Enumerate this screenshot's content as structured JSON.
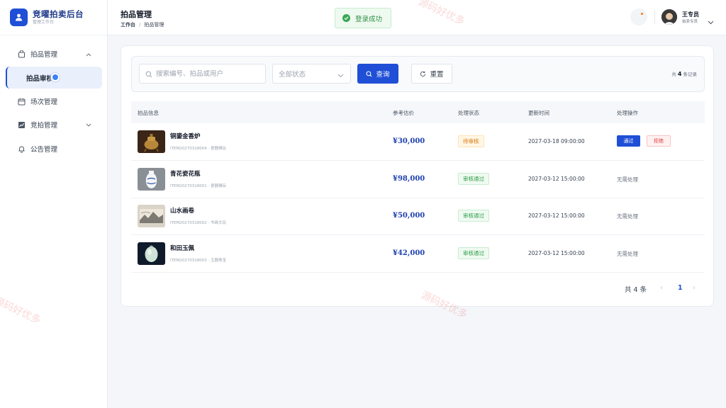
{
  "brand": {
    "title": "竞曜拍卖后台",
    "subtitle": "管理工作台"
  },
  "sidebar": {
    "items": [
      {
        "label": "拍品管理",
        "icon": "bag-icon"
      },
      {
        "label": "拍品审核",
        "icon": ""
      },
      {
        "label": "场次管理",
        "icon": "calendar-icon"
      },
      {
        "label": "竞拍管理",
        "icon": "chart-icon"
      },
      {
        "label": "公告管理",
        "icon": "bell-icon"
      }
    ]
  },
  "header": {
    "title": "拍品管理",
    "breadcrumb": [
      "工作台",
      "拍品管理"
    ],
    "toast": "登录成功",
    "user": {
      "name": "王专员",
      "role": "拍卖专员"
    }
  },
  "filter": {
    "search_placeholder": "搜索编号、拍品或用户",
    "status_select": "全部状态",
    "query_label": "查询",
    "reset_label": "重置",
    "count_prefix": "共",
    "count": "4",
    "count_suffix": "条记录"
  },
  "table": {
    "columns": [
      "拍品信息",
      "参考估价",
      "处理状态",
      "更新时间",
      "处理操作"
    ],
    "rows": [
      {
        "name": "铜鎏金香炉",
        "id": "ITEM20270318004 · 瓷器雅玩",
        "price": "¥30,000",
        "status": "待审核",
        "status_type": "pending",
        "time": "2027-03-18 09:00:00",
        "action_pass": "通过",
        "action_reject": "拒绝"
      },
      {
        "name": "青花瓷花瓶",
        "id": "ITEM20270318001 · 瓷器雅玩",
        "price": "¥98,000",
        "status": "审核通过",
        "status_type": "ok",
        "time": "2027-03-12 15:00:00",
        "action": "无需处理"
      },
      {
        "name": "山水画卷",
        "id": "ITEM20270318002 · 书画文玩",
        "price": "¥50,000",
        "status": "审核通过",
        "status_type": "ok",
        "time": "2027-03-12 15:00:00",
        "action": "无需处理"
      },
      {
        "name": "和田玉佩",
        "id": "ITEM20270318003 · 玉器珠宝",
        "price": "¥42,000",
        "status": "审核通过",
        "status_type": "ok",
        "time": "2027-03-12 15:00:00",
        "action": "无需处理"
      }
    ]
  },
  "pager": {
    "total": "共 4 条",
    "current": "1",
    "prev": "‹",
    "next": "›"
  },
  "watermark": "源码好优多",
  "colors": {
    "primary": "#1f4fd6",
    "success": "#2f9e4a",
    "warning": "#d97706",
    "danger": "#e53e3e"
  }
}
